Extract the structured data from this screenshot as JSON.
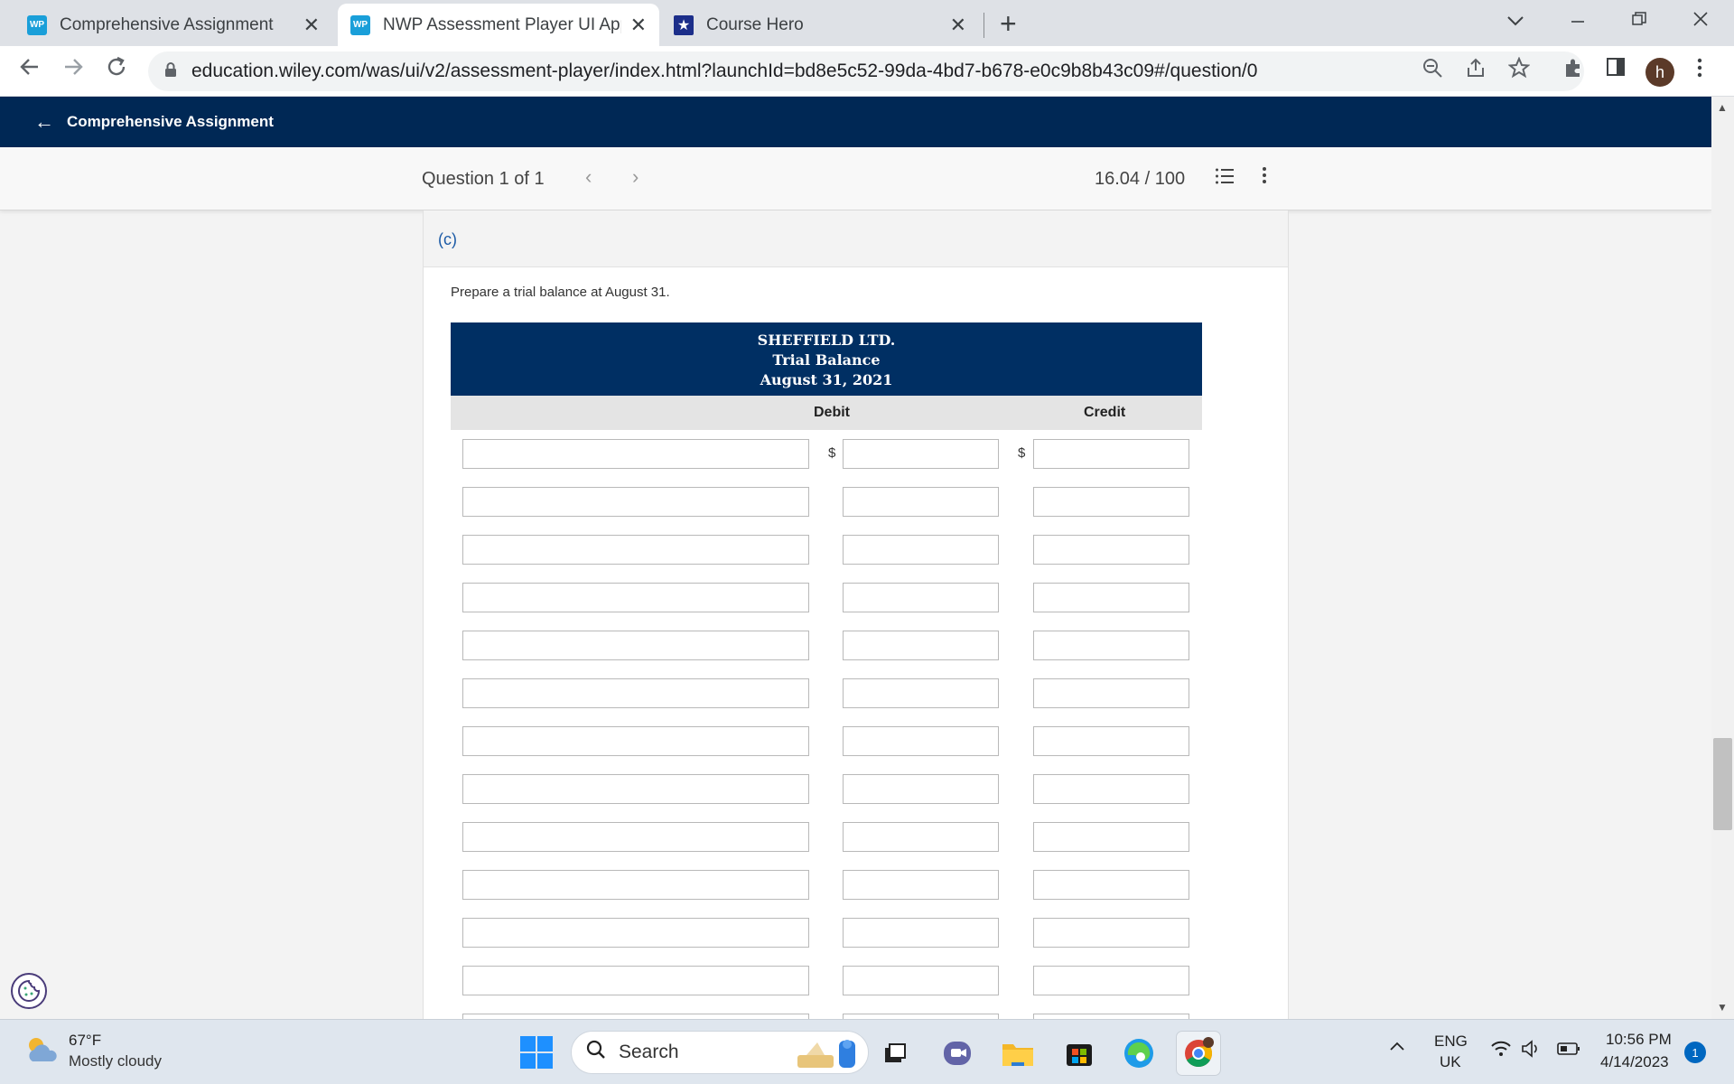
{
  "browser": {
    "tabs": [
      {
        "title": "Comprehensive Assignment",
        "favicon": "WP",
        "active": false
      },
      {
        "title": "NWP Assessment Player UI Appli",
        "favicon": "WP",
        "active": true
      },
      {
        "title": "Course Hero",
        "favicon": "★",
        "active": false
      }
    ],
    "close_glyph": "✕",
    "new_tab_glyph": "+",
    "url": "education.wiley.com/was/ui/v2/assessment-player/index.html?launchId=bd8e5c52-99da-4bd7-b678-e0c9b8b43c09#/question/0",
    "profile_initial": "h"
  },
  "header": {
    "back_glyph": "←",
    "title": "Comprehensive Assignment"
  },
  "question_bar": {
    "label": "Question 1 of 1",
    "prev_glyph": "‹",
    "next_glyph": "›",
    "score": "16.04 / 100"
  },
  "part": {
    "label": "(c)",
    "instruction": "Prepare a trial balance at August 31."
  },
  "trial_balance": {
    "company": "SHEFFIELD LTD.",
    "statement": "Trial Balance",
    "date": "August 31, 2021",
    "columns": {
      "debit": "Debit",
      "credit": "Credit"
    },
    "currency_symbol": "$",
    "rows": [
      "",
      "",
      "",
      "",
      "",
      "",
      "",
      "",
      "",
      "",
      "",
      "",
      ""
    ]
  },
  "taskbar": {
    "weather_temp": "67°F",
    "weather_desc": "Mostly cloudy",
    "search_label": "Search",
    "lang_top": "ENG",
    "lang_bottom": "UK",
    "time": "10:56 PM",
    "date": "4/14/2023",
    "notifications": "1"
  },
  "colors": {
    "header_navy": "#002855",
    "table_header_navy": "#002f63",
    "part_label_blue": "#1b5aa6"
  }
}
